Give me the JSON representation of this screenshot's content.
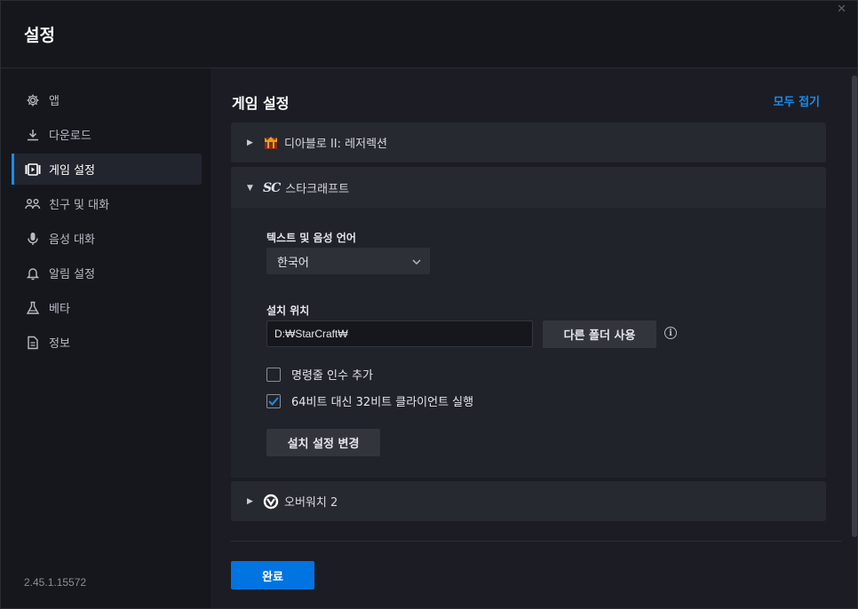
{
  "window": {
    "title": "설정",
    "close_glyph": "✕"
  },
  "sidebar": {
    "items": [
      {
        "label": "앱",
        "icon": "gear-icon"
      },
      {
        "label": "다운로드",
        "icon": "download-icon"
      },
      {
        "label": "게임 설정",
        "icon": "game-settings-icon",
        "active": true
      },
      {
        "label": "친구 및 대화",
        "icon": "friends-icon"
      },
      {
        "label": "음성 대화",
        "icon": "microphone-icon"
      },
      {
        "label": "알림 설정",
        "icon": "bell-icon"
      },
      {
        "label": "베타",
        "icon": "flask-icon"
      },
      {
        "label": "정보",
        "icon": "document-icon"
      }
    ],
    "version": "2.45.1.15572"
  },
  "main": {
    "heading": "게임 설정",
    "collapse_all": "모두 접기",
    "games": [
      {
        "name": "디아블로 II: 레저렉션",
        "expanded": false,
        "icon": "diablo-icon"
      },
      {
        "name": "스타크래프트",
        "expanded": true,
        "icon": "starcraft-icon",
        "logo_text": "SC"
      },
      {
        "name": "오버워치 2",
        "expanded": false,
        "icon": "overwatch-icon"
      }
    ],
    "starcraft": {
      "language_label": "텍스트 및 음성 언어",
      "language_value": "한국어",
      "install_label": "설치 위치",
      "install_path": "D:₩StarCraft₩",
      "other_folder_button": "다른 폴더 사용",
      "info_glyph": "i",
      "checkbox_cmdline": {
        "label": "명령줄 인수 추가",
        "checked": false
      },
      "checkbox_32bit": {
        "label": "64비트 대신 32비트 클라이언트 실행",
        "checked": true
      },
      "apply_button": "설치 설정 변경"
    },
    "done_button": "완료"
  },
  "colors": {
    "accent": "#1a8cf0",
    "primary_button": "#0074e0",
    "background": "#16171d"
  }
}
